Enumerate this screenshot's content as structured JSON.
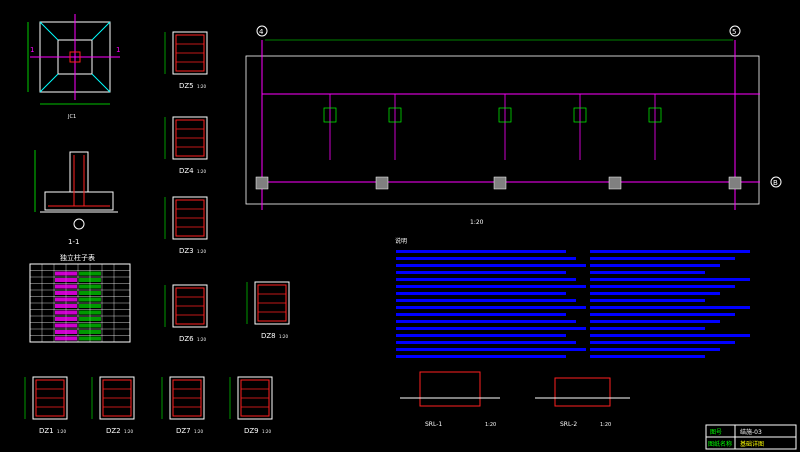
{
  "colors": {
    "background": "#000000",
    "grid_line": "#ff00ff",
    "outline": "#ffffff",
    "rebar": "#ff2020",
    "dimension": "#00ff00",
    "label": "#ffff00",
    "column": "#808080",
    "notes": "#0000ff",
    "cyan": "#00ffff"
  },
  "drawing": {
    "plan_title": "1-1",
    "axis_left": "4",
    "axis_right": "5",
    "axis_bottom": "B",
    "scale_plan": "1:20",
    "section_label": "1-1",
    "foundation_title": "JC1",
    "notes_title": "说明",
    "table_title": "独立柱子表"
  },
  "details": [
    {
      "name": "DZ5",
      "scale": "1:20"
    },
    {
      "name": "DZ4",
      "scale": "1:20"
    },
    {
      "name": "DZ3",
      "scale": "1:20"
    },
    {
      "name": "DZ6",
      "scale": "1:20"
    },
    {
      "name": "DZ8",
      "scale": "1:20"
    },
    {
      "name": "DZ1",
      "scale": "1:20"
    },
    {
      "name": "DZ2",
      "scale": "1:20"
    },
    {
      "name": "DZ7",
      "scale": "1:20"
    },
    {
      "name": "DZ9",
      "scale": "1:20"
    }
  ],
  "sections": [
    {
      "label": "SRL-1",
      "scale": "1:20"
    },
    {
      "label": "SRL-2",
      "scale": "1:20"
    }
  ],
  "title_block": {
    "row1_left": "图号",
    "row1_right": "结施-03",
    "row2_left": "图纸名称",
    "row2_right": "基础详图"
  }
}
